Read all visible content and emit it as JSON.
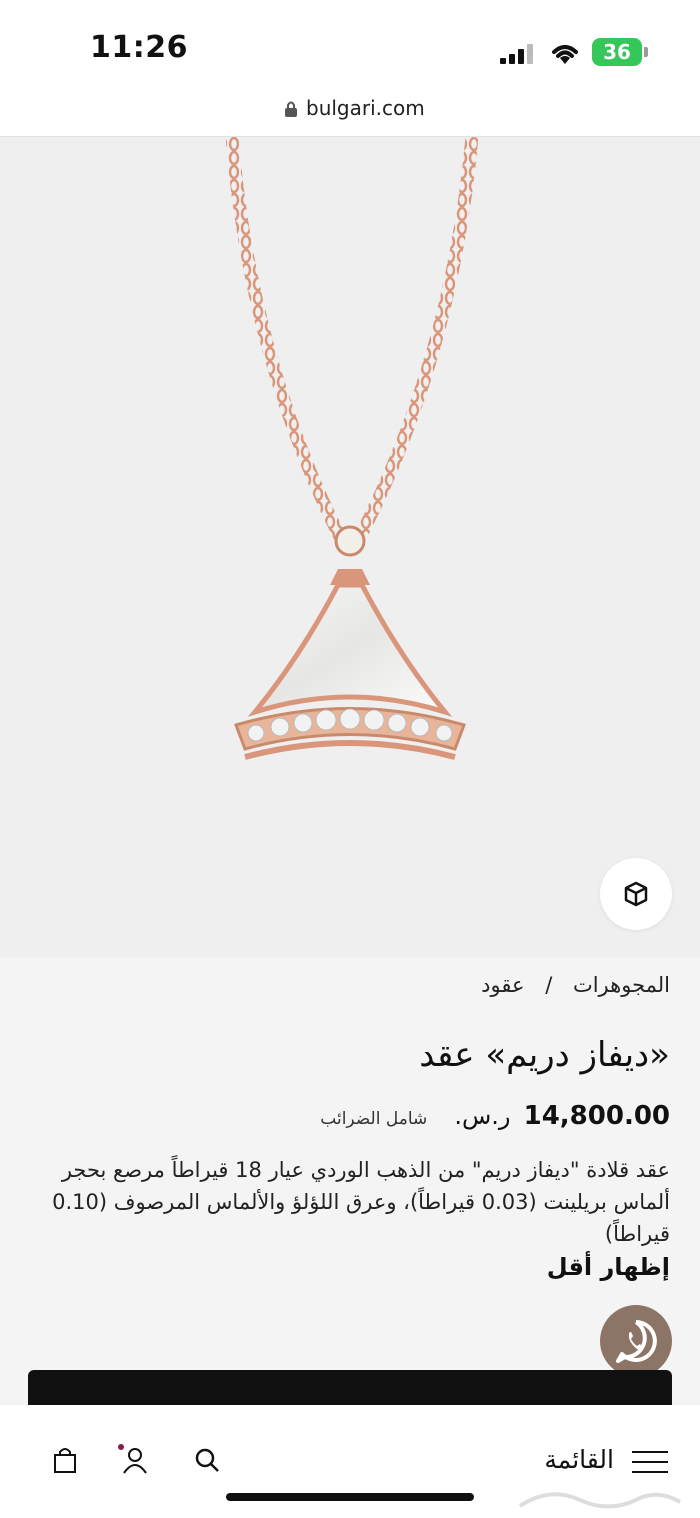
{
  "status_bar": {
    "time": "11:26",
    "battery": "36"
  },
  "browser": {
    "url": "bulgari.com"
  },
  "breadcrumb": {
    "parent": "المجوهرات",
    "separator": "/",
    "current": "عقود"
  },
  "product": {
    "title": "«ديفاز دريم» عقد",
    "price": "14,800.00",
    "currency": "ر.س.",
    "tax_note": "شامل الضرائب",
    "description": "عقد قلادة \"ديفاز دريم\" من الذهب الوردي عيار 18 قيراطاً مرصع بحجر ألماس بريلينت (0.03 قيراطاً)، وعرق اللؤلؤ والألماس المرصوف (0.10 قيراطاً)",
    "show_less": "إظهار أقل"
  },
  "bottom_nav": {
    "menu_label": "القائمة"
  },
  "icons": [
    "lock-icon",
    "cube-3d-icon",
    "whatsapp-icon",
    "bag-icon",
    "user-icon",
    "search-icon",
    "menu-icon"
  ],
  "colors": {
    "whatsapp_bg": "#8c7566",
    "battery": "#35c759",
    "rose_gold": "#d99a78"
  }
}
